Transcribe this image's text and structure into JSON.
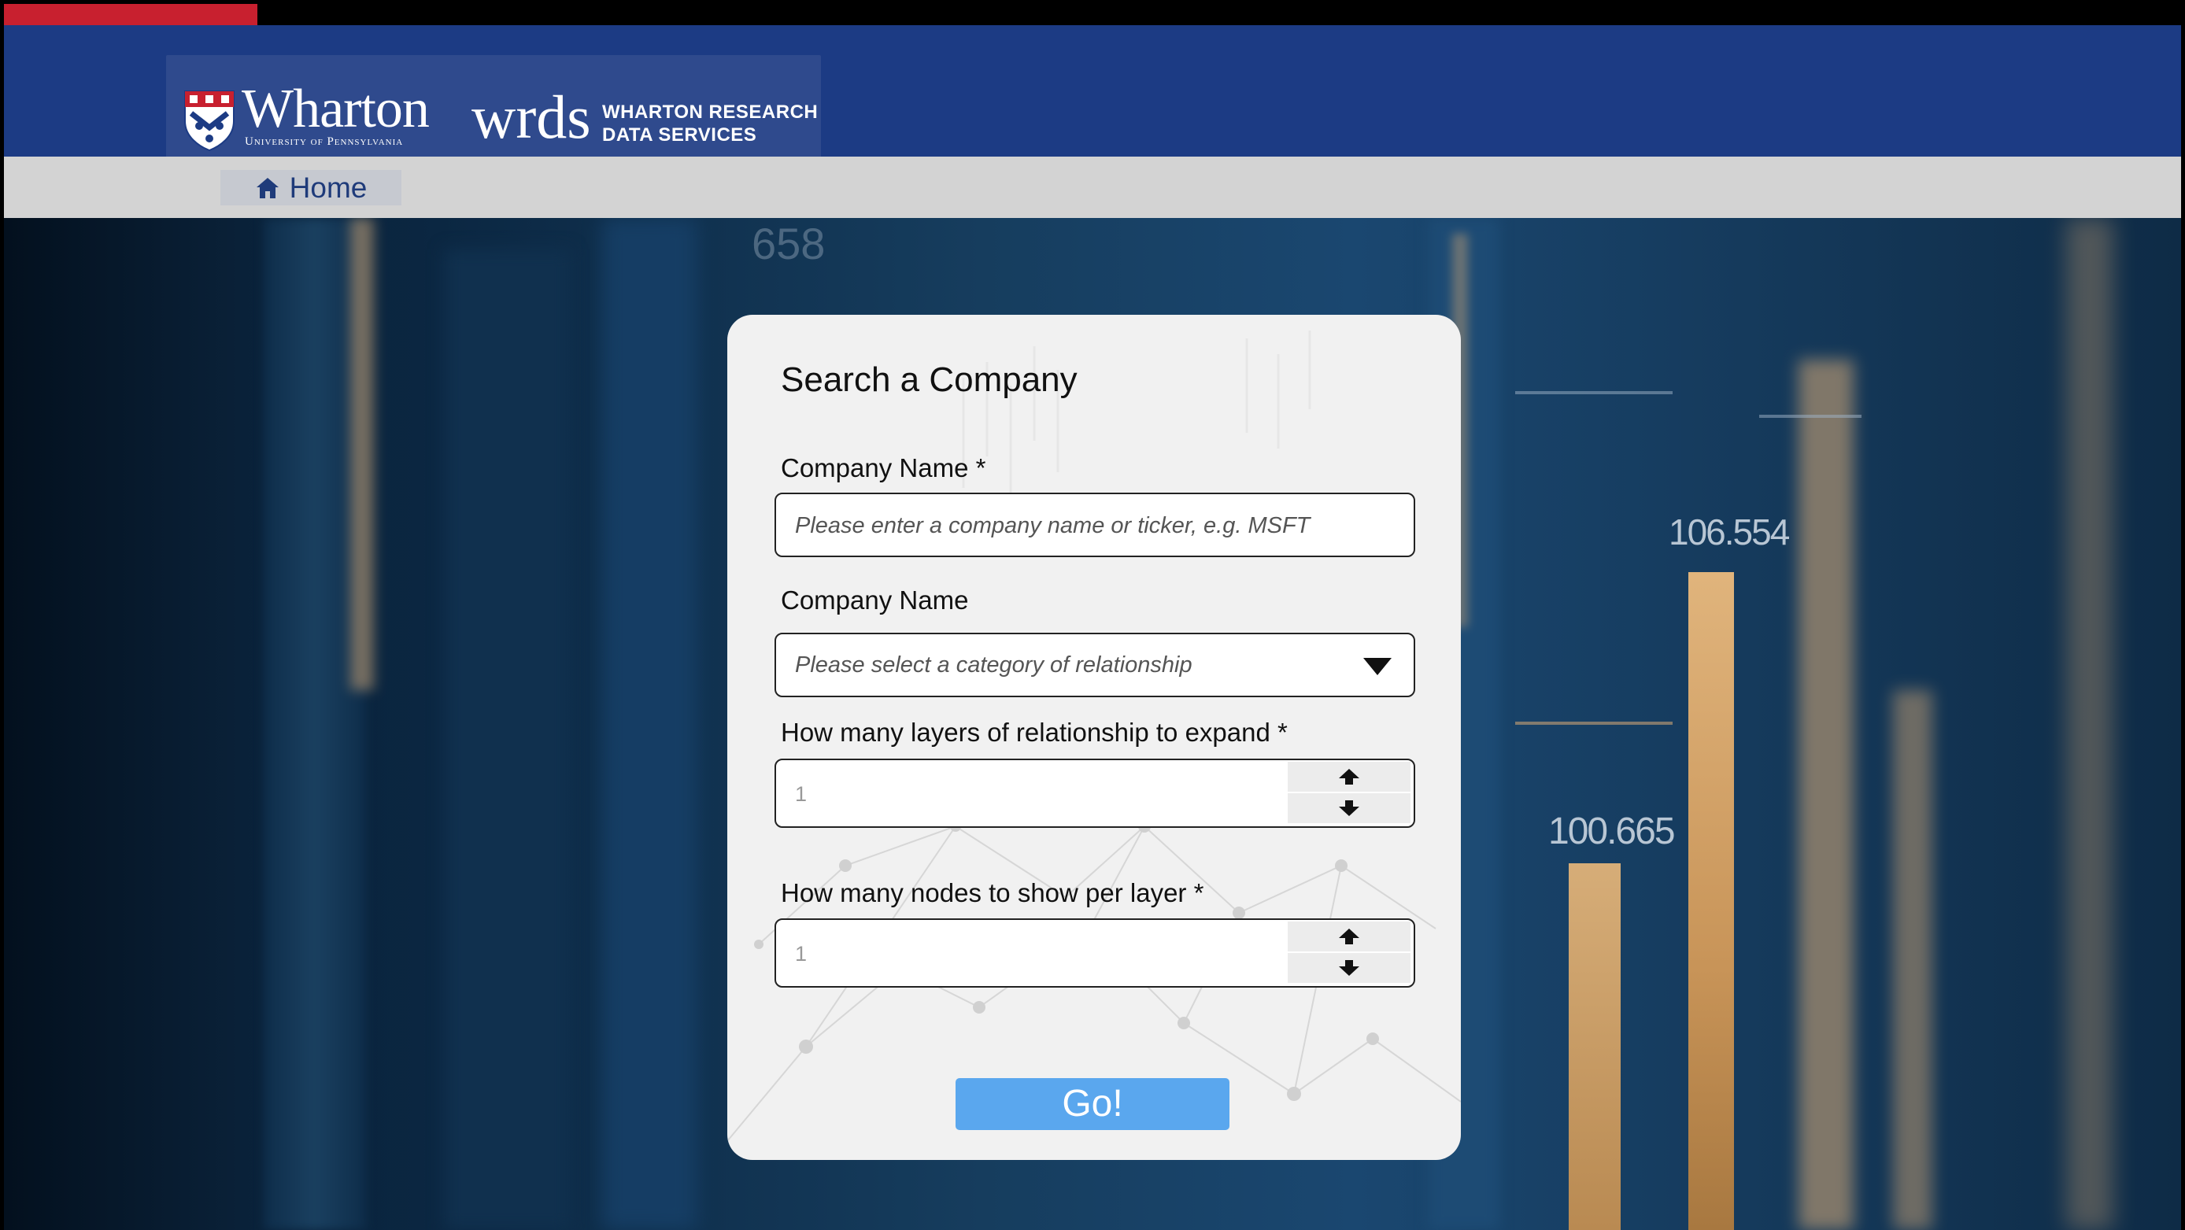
{
  "header": {
    "brand": "Wharton",
    "university": "University of Pennsylvania",
    "wrds": "wrds",
    "wrds_line1": "WHARTON RESEARCH",
    "wrds_line2": "DATA SERVICES"
  },
  "nav": {
    "home_label": "Home"
  },
  "background": {
    "number1": "106.554",
    "number2": "100.665",
    "number3": "658"
  },
  "form": {
    "title": "Search a Company",
    "company_label": "Company Name *",
    "company_placeholder": "Please enter a company name or ticker, e.g. MSFT",
    "relationship_label": "Company Name",
    "relationship_placeholder": "Please select a category of relationship",
    "layers_label": "How many layers of relationship to expand *",
    "layers_value": "1",
    "nodes_label": "How many nodes to show per layer *",
    "nodes_value": "1",
    "submit_label": "Go!"
  },
  "colors": {
    "header_blue": "#1c3b84",
    "accent_red": "#c8202f",
    "nav_gray": "#d3d3d3",
    "button_blue": "#5aa7ee",
    "home_text": "#1f3b7a"
  }
}
